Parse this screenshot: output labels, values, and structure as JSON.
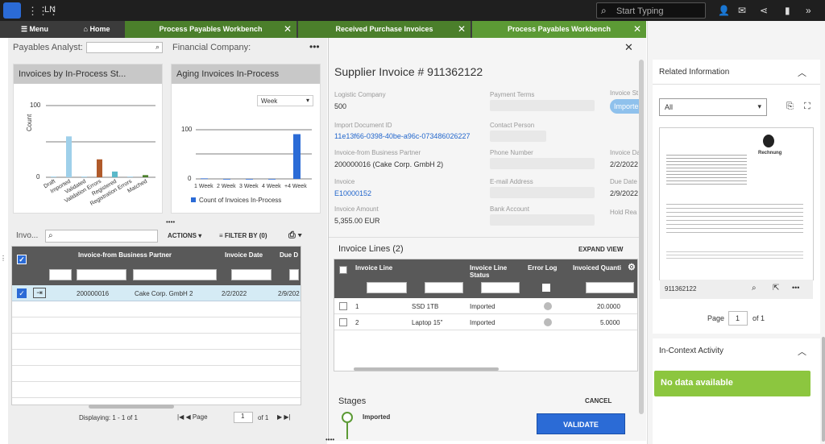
{
  "app": {
    "name": "LN",
    "search_placeholder": "Start Typing"
  },
  "tabs": {
    "menu": "Menu",
    "home": "Home",
    "tab1": "Process Payables Workbench",
    "tab2": "Received Purchase Invoices",
    "tab3": "Process Payables Workbench"
  },
  "filters": {
    "analyst_label": "Payables Analyst:",
    "company_label": "Financial Company:"
  },
  "chart1": {
    "title": "Invoices by In-Process St...",
    "ylabel": "Count",
    "ytick": "100",
    "ytick0": "0"
  },
  "chart2": {
    "title": "Aging Invoices In-Process",
    "dropdown": "Week",
    "ytick": "100",
    "ytick0": "0",
    "legend": "Count of Invoices In-Process"
  },
  "chart_data": [
    {
      "type": "bar",
      "title": "Invoices by In-Process St...",
      "categories": [
        "Draft",
        "Imported",
        "Validated",
        "Validation Errors",
        "Registered",
        "Registration Errors",
        "Matched"
      ],
      "values": [
        1,
        57,
        1,
        25,
        8,
        1,
        3
      ],
      "ylabel": "Count",
      "ylim": [
        0,
        100
      ],
      "colors": [
        "#9fd0ea",
        "#9fd0ea",
        "#9fd0ea",
        "#b05a2a",
        "#5bb8c9",
        "#9fd0ea",
        "#4b7f2b"
      ]
    },
    {
      "type": "bar",
      "title": "Aging Invoices In-Process",
      "categories": [
        "1 Week",
        "2 Week",
        "3 Week",
        "4 Week",
        "+4 Week"
      ],
      "values": [
        1,
        0,
        0,
        0,
        91
      ],
      "ylim": [
        0,
        100
      ],
      "series": [
        {
          "name": "Count of Invoices In-Process",
          "values": [
            1,
            0,
            0,
            0,
            91
          ]
        }
      ],
      "color": "#2b6bd6"
    }
  ],
  "grid": {
    "title": "Invo...",
    "actions": "ACTIONS",
    "filter": "FILTER BY (0)",
    "col_bp": "Invoice-from Business Partner",
    "col_date": "Invoice Date",
    "col_due": "Due D",
    "rows": [
      {
        "bp": "200000016",
        "name": "Cake Corp. GmbH 2",
        "date": "2/2/2022",
        "due": "2/9/202"
      }
    ],
    "displaying": "Displaying: 1 - 1 of 1",
    "page_label": "Page",
    "page": "1",
    "of": "of 1"
  },
  "invoice": {
    "title": "Supplier Invoice # 911362122",
    "logistic_company_label": "Logistic Company",
    "logistic_company": "500",
    "import_doc_label": "Import Document ID",
    "import_doc": "11e13f66-0398-40be-a96c-073486026227",
    "bp_label": "Invoice-from Business Partner",
    "bp": "200000016 (Cake Corp. GmbH 2)",
    "invoice_label": "Invoice",
    "invoice_no": "E10000152",
    "amount_label": "Invoice Amount",
    "amount": "5,355.00 EUR",
    "payment_terms_label": "Payment Terms",
    "contact_label": "Contact Person",
    "phone_label": "Phone Number",
    "email_label": "E-mail Address",
    "bank_label": "Bank Account",
    "status_label": "Invoice St",
    "status": "Importe",
    "date_label": "Invoice Da",
    "date": "2/2/2022",
    "due_label": "Due Date",
    "due": "2/9/2022",
    "hold_label": "Hold Rea"
  },
  "lines": {
    "title": "Invoice Lines (2)",
    "expand": "EXPAND VIEW",
    "col_line": "Invoice Line",
    "col_status": "Invoice Line Status",
    "col_err": "Error Log",
    "col_qty": "Invoiced Quanti",
    "rows": [
      {
        "n": "1",
        "item": "SSD 1TB",
        "status": "Imported",
        "qty": "20.0000"
      },
      {
        "n": "2",
        "item": "Laptop 15\"",
        "status": "Imported",
        "qty": "5.0000"
      }
    ]
  },
  "stages": {
    "title": "Stages",
    "cancel": "CANCEL",
    "imported": "Imported",
    "validate": "VALIDATE"
  },
  "related": {
    "title": "Related Information",
    "filter": "All",
    "doc_name": "911362122",
    "page_label": "Page",
    "page": "1",
    "of": "of 1",
    "rechnung": "Rechnung"
  },
  "activity": {
    "title": "In-Context Activity",
    "empty": "No data available"
  }
}
